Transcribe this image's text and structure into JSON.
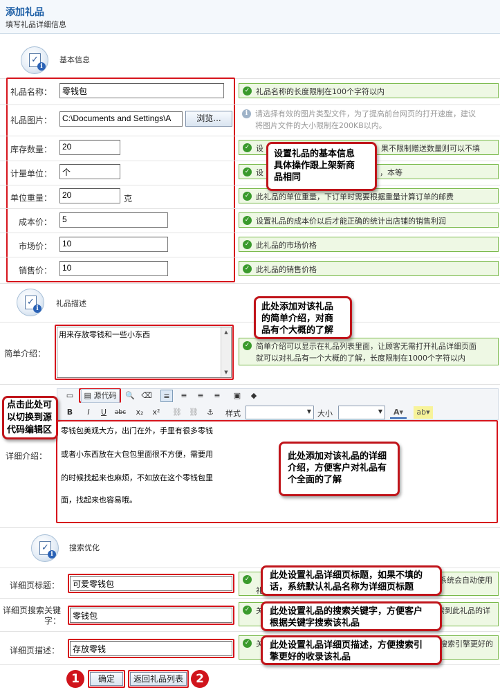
{
  "header": {
    "title": "添加礼品",
    "subtitle": "填写礼品详细信息"
  },
  "sections": {
    "basic": "基本信息",
    "desc": "礼品描述",
    "seo": "搜索优化"
  },
  "fields": {
    "name": {
      "label": "礼品名称：",
      "value": "零钱包",
      "hint": "礼品名称的长度限制在100个字符以内"
    },
    "image": {
      "label": "礼品图片：",
      "value": "C:\\Documents and Settings\\A",
      "browse": "浏览...",
      "hint_line1": "请选择有效的图片类型文件，为了提高前台网页的打开速度，建议",
      "hint_line2": "将图片文件的大小限制在200KB以内。"
    },
    "stock": {
      "label": "库存数量：",
      "value": "20",
      "hint_start": "设",
      "hint_end": "果不限制赠送数量则可以不填"
    },
    "unit": {
      "label": "计量单位：",
      "value": "个",
      "hint_start": "设",
      "hint_end": "，本等"
    },
    "weight": {
      "label": "单位重量：",
      "value": "20",
      "unit": "克",
      "hint": "此礼品的单位重量，下订单时需要根据重量计算订单的邮费"
    },
    "cost": {
      "label": "成本价：",
      "value": "5",
      "hint": "设置礼品的成本价以后才能正确的统计出店铺的销售利润"
    },
    "market": {
      "label": "市场价：",
      "value": "10",
      "hint": "此礼品的市场价格"
    },
    "sale": {
      "label": "销售价：",
      "value": "10",
      "hint": "此礼品的销售价格"
    },
    "brief": {
      "label": "简单介绍：",
      "value": "用来存放零钱和一些小东西",
      "hint_line1": "简单介绍可以显示在礼品列表里面，让顾客无需打开礼品详细页面",
      "hint_line2": "就可以对礼品有一个大概的了解，长度限制在1000个字符以内"
    },
    "detail": {
      "label": "详细介绍：",
      "lines": [
        "零钱包美观大方，出门在外，手里有很多零钱",
        "或者小东西放在大包包里面很不方便，需要用",
        "的时候找起来也麻烦，不如放在这个零钱包里",
        "面，找起来也容易哦。"
      ]
    },
    "seo_title": {
      "label": "详细页标题：",
      "value": "可爱零钱包",
      "hint_start": "礼",
      "hint_end": "系统会自动使用"
    },
    "seo_keywords": {
      "label_line1": "详细页搜索关键",
      "label_line2": "字：",
      "value": "零钱包",
      "hint_start": "关",
      "hint_end": "索到此礼品的详"
    },
    "seo_desc": {
      "label": "详细页描述：",
      "value": "存放零钱",
      "hint_start": "关",
      "hint_end": "搜索引擎更好的"
    }
  },
  "editor": {
    "source_label": "源代码",
    "style_label": "样式",
    "size_label": "大小",
    "bold": "B",
    "italic": "I",
    "underline": "U",
    "strike": "abc",
    "sub": "x₂",
    "sup": "x²"
  },
  "callouts": {
    "basic": [
      "设置礼品的基本信息",
      "具体操作跟上架新商",
      "品相同"
    ],
    "brief": [
      "此处添加对该礼品",
      "的简单介绍，对商",
      "品有个大概的了解"
    ],
    "source": [
      "点击此处可",
      "以切换到源",
      "代码编辑区"
    ],
    "detail": [
      "此处添加对该礼品的详细",
      "介绍，方便客户对礼品有",
      "个全面的了解"
    ],
    "seo_title": [
      "此处设置礼品详细页标题，如果不填的",
      "话，系统默认礼品名称为详细页标题"
    ],
    "seo_keywords": [
      "此处设置礼品的搜索关键字，方便客户",
      "根据关键字搜索该礼品"
    ],
    "seo_desc": [
      "此处设置礼品详细页描述，方便搜索引",
      "擎更好的收录该礼品"
    ]
  },
  "buttons": {
    "confirm": "确定",
    "back": "返回礼品列表",
    "num1": "1",
    "num2": "2"
  }
}
